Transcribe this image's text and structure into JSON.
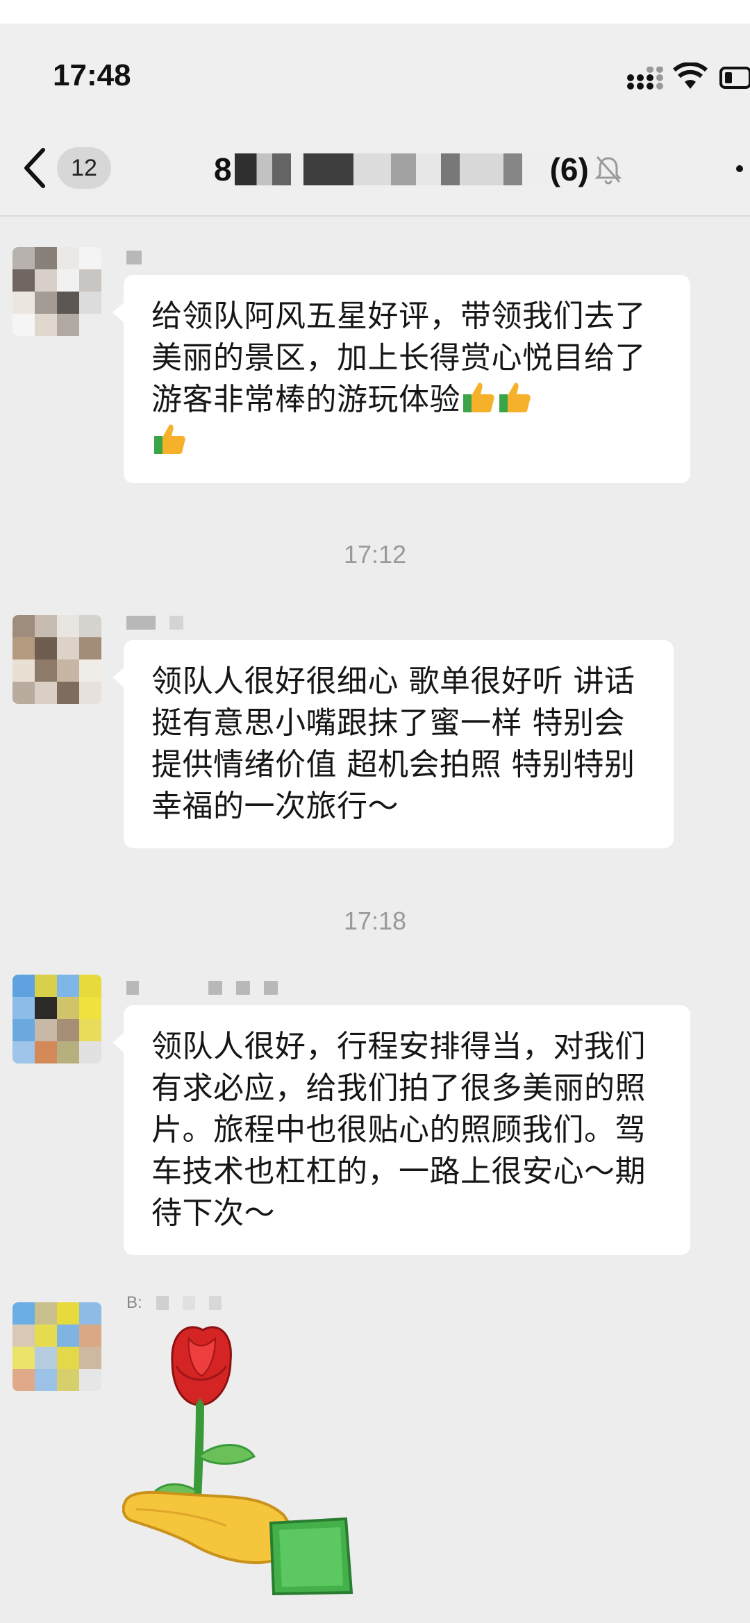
{
  "status_bar": {
    "time": "17:48"
  },
  "nav": {
    "unread_count": "12",
    "title_prefix": "8",
    "member_count": "(6)"
  },
  "messages": [
    {
      "text": "给领队阿风五星好评，带领我们去了美丽的景区，加上长得赏心悦目给了游客非常棒的游玩体验",
      "emoji": [
        "thumbs-up",
        "thumbs-up",
        "thumbs-up"
      ]
    },
    {
      "timestamp": "17:12",
      "text": "领队人很好很细心 歌单很好听 讲话挺有意思小嘴跟抹了蜜一样 特别会提供情绪价值 超机会拍照 特别特别幸福的一次旅行～"
    },
    {
      "timestamp": "17:18",
      "text": "领队人很好，行程安排得当，对我们有求必应，给我们拍了很多美丽的照片。旅程中也很贴心的照顾我们。驾车技术也杠杠的，一路上很安心～期待下次～"
    },
    {
      "sender_visible": "B:",
      "sticker": "rose-in-hand"
    }
  ],
  "colors": {
    "background": "#ededed",
    "bubble": "#ffffff",
    "timestamp": "#9a9a9a",
    "text": "#161616"
  }
}
